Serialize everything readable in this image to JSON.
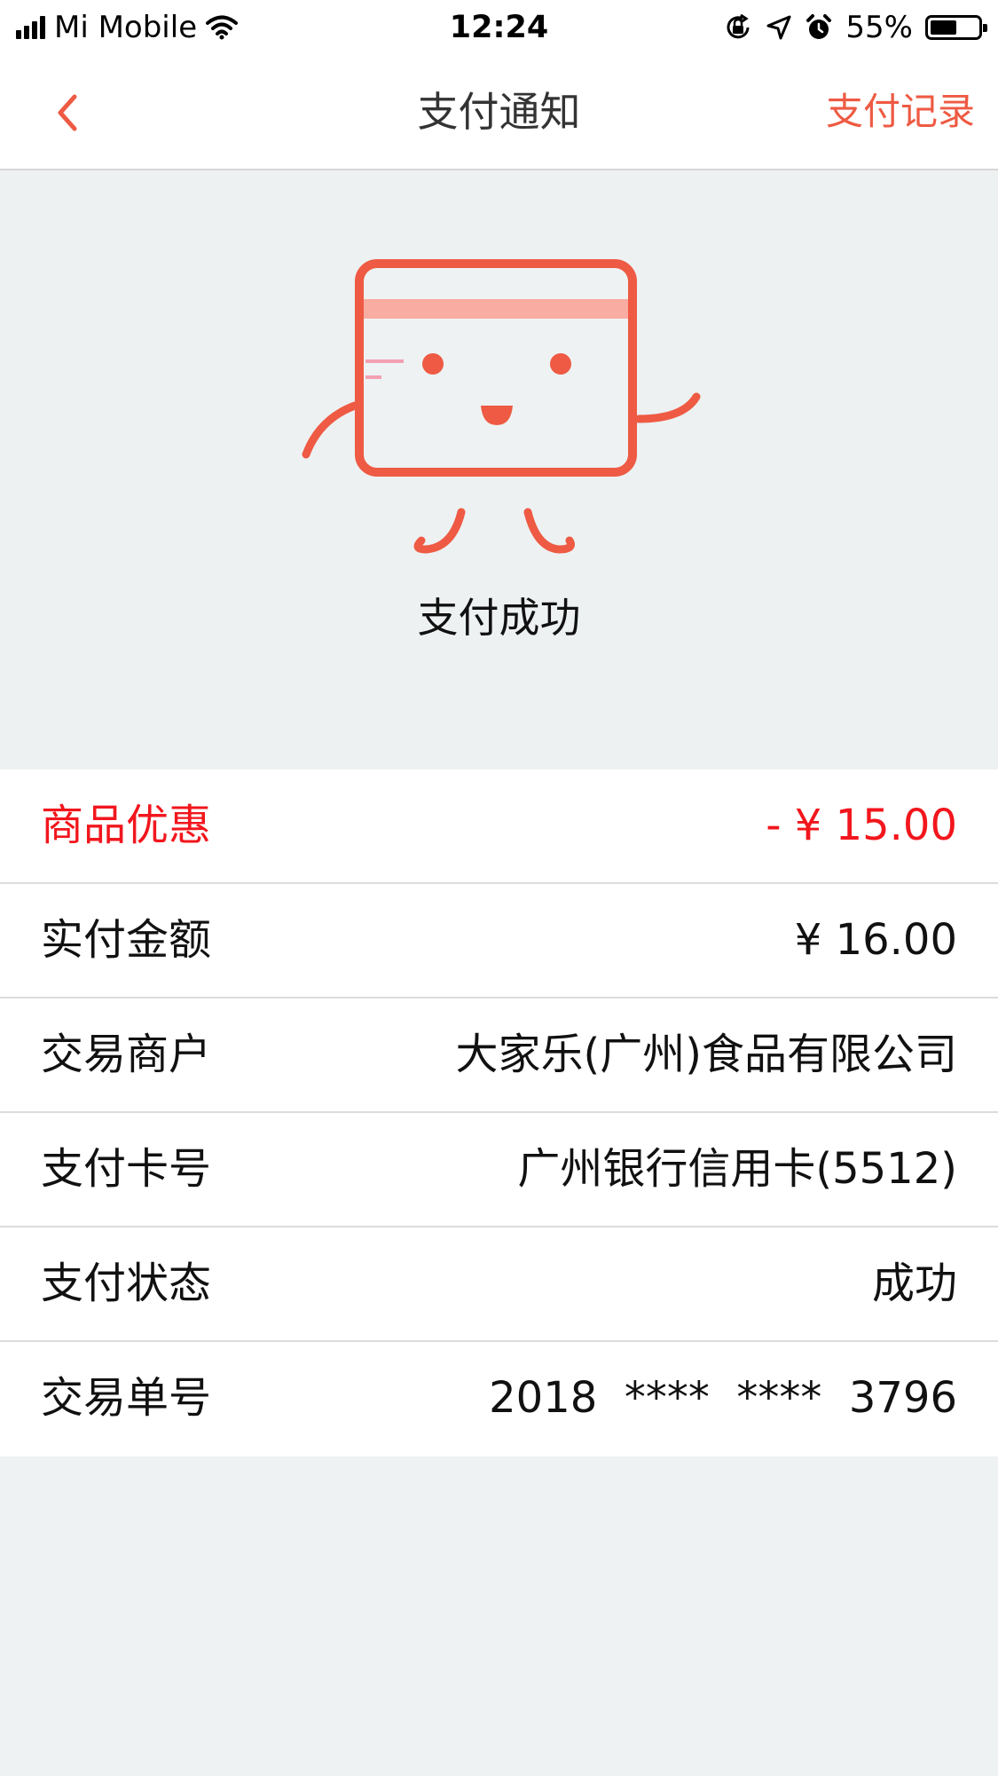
{
  "status_bar": {
    "carrier": "Mi Mobile",
    "time": "12:24",
    "battery_percent": "55%",
    "battery_level": 0.55,
    "icons": [
      "signal-icon",
      "wifi-icon",
      "orientation-lock-icon",
      "location-arrow-icon",
      "alarm-icon",
      "battery-icon"
    ]
  },
  "nav": {
    "back_icon": "chevron-left-icon",
    "title": "支付通知",
    "records_label": "支付记录"
  },
  "hero": {
    "mascot": "credit-card-mascot-icon",
    "status_text": "支付成功"
  },
  "details": {
    "rows": [
      {
        "label": "商品优惠",
        "value": "- ¥ 15.00",
        "highlight": true
      },
      {
        "label": "实付金额",
        "value": "¥ 16.00"
      },
      {
        "label": "交易商户",
        "value": "大家乐(广州)食品有限公司"
      },
      {
        "label": "支付卡号",
        "value": "广州银行信用卡(5512)"
      },
      {
        "label": "支付状态",
        "value": "成功"
      },
      {
        "label": "交易单号",
        "value": "2018  ****  ****  3796"
      }
    ]
  },
  "colors": {
    "accent": "#ee5a43",
    "discount": "#f2161d",
    "background": "#edf1f2",
    "mascot": "#ee5a43",
    "mascot_stripe": "#f9aca1"
  }
}
